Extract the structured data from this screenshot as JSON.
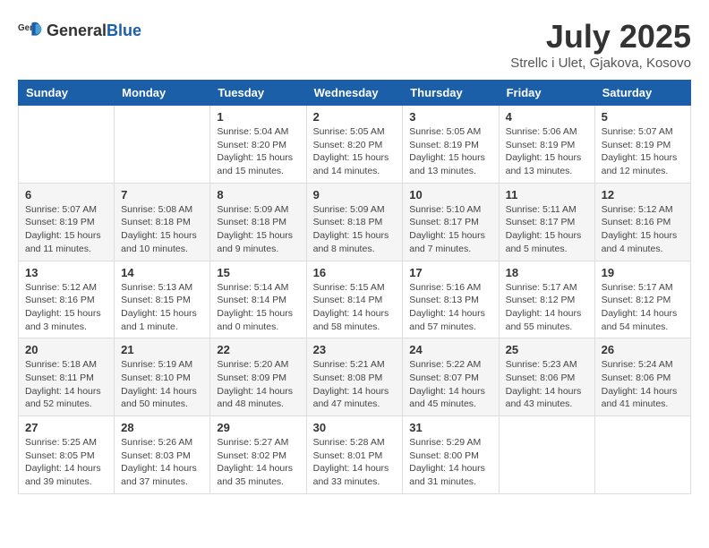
{
  "header": {
    "logo_general": "General",
    "logo_blue": "Blue",
    "month_title": "July 2025",
    "location": "Strellc i Ulet, Gjakova, Kosovo"
  },
  "weekdays": [
    "Sunday",
    "Monday",
    "Tuesday",
    "Wednesday",
    "Thursday",
    "Friday",
    "Saturday"
  ],
  "weeks": [
    [
      {
        "day": "",
        "info": ""
      },
      {
        "day": "",
        "info": ""
      },
      {
        "day": "1",
        "info": "Sunrise: 5:04 AM\nSunset: 8:20 PM\nDaylight: 15 hours and 15 minutes."
      },
      {
        "day": "2",
        "info": "Sunrise: 5:05 AM\nSunset: 8:20 PM\nDaylight: 15 hours and 14 minutes."
      },
      {
        "day": "3",
        "info": "Sunrise: 5:05 AM\nSunset: 8:19 PM\nDaylight: 15 hours and 13 minutes."
      },
      {
        "day": "4",
        "info": "Sunrise: 5:06 AM\nSunset: 8:19 PM\nDaylight: 15 hours and 13 minutes."
      },
      {
        "day": "5",
        "info": "Sunrise: 5:07 AM\nSunset: 8:19 PM\nDaylight: 15 hours and 12 minutes."
      }
    ],
    [
      {
        "day": "6",
        "info": "Sunrise: 5:07 AM\nSunset: 8:19 PM\nDaylight: 15 hours and 11 minutes."
      },
      {
        "day": "7",
        "info": "Sunrise: 5:08 AM\nSunset: 8:18 PM\nDaylight: 15 hours and 10 minutes."
      },
      {
        "day": "8",
        "info": "Sunrise: 5:09 AM\nSunset: 8:18 PM\nDaylight: 15 hours and 9 minutes."
      },
      {
        "day": "9",
        "info": "Sunrise: 5:09 AM\nSunset: 8:18 PM\nDaylight: 15 hours and 8 minutes."
      },
      {
        "day": "10",
        "info": "Sunrise: 5:10 AM\nSunset: 8:17 PM\nDaylight: 15 hours and 7 minutes."
      },
      {
        "day": "11",
        "info": "Sunrise: 5:11 AM\nSunset: 8:17 PM\nDaylight: 15 hours and 5 minutes."
      },
      {
        "day": "12",
        "info": "Sunrise: 5:12 AM\nSunset: 8:16 PM\nDaylight: 15 hours and 4 minutes."
      }
    ],
    [
      {
        "day": "13",
        "info": "Sunrise: 5:12 AM\nSunset: 8:16 PM\nDaylight: 15 hours and 3 minutes."
      },
      {
        "day": "14",
        "info": "Sunrise: 5:13 AM\nSunset: 8:15 PM\nDaylight: 15 hours and 1 minute."
      },
      {
        "day": "15",
        "info": "Sunrise: 5:14 AM\nSunset: 8:14 PM\nDaylight: 15 hours and 0 minutes."
      },
      {
        "day": "16",
        "info": "Sunrise: 5:15 AM\nSunset: 8:14 PM\nDaylight: 14 hours and 58 minutes."
      },
      {
        "day": "17",
        "info": "Sunrise: 5:16 AM\nSunset: 8:13 PM\nDaylight: 14 hours and 57 minutes."
      },
      {
        "day": "18",
        "info": "Sunrise: 5:17 AM\nSunset: 8:12 PM\nDaylight: 14 hours and 55 minutes."
      },
      {
        "day": "19",
        "info": "Sunrise: 5:17 AM\nSunset: 8:12 PM\nDaylight: 14 hours and 54 minutes."
      }
    ],
    [
      {
        "day": "20",
        "info": "Sunrise: 5:18 AM\nSunset: 8:11 PM\nDaylight: 14 hours and 52 minutes."
      },
      {
        "day": "21",
        "info": "Sunrise: 5:19 AM\nSunset: 8:10 PM\nDaylight: 14 hours and 50 minutes."
      },
      {
        "day": "22",
        "info": "Sunrise: 5:20 AM\nSunset: 8:09 PM\nDaylight: 14 hours and 48 minutes."
      },
      {
        "day": "23",
        "info": "Sunrise: 5:21 AM\nSunset: 8:08 PM\nDaylight: 14 hours and 47 minutes."
      },
      {
        "day": "24",
        "info": "Sunrise: 5:22 AM\nSunset: 8:07 PM\nDaylight: 14 hours and 45 minutes."
      },
      {
        "day": "25",
        "info": "Sunrise: 5:23 AM\nSunset: 8:06 PM\nDaylight: 14 hours and 43 minutes."
      },
      {
        "day": "26",
        "info": "Sunrise: 5:24 AM\nSunset: 8:06 PM\nDaylight: 14 hours and 41 minutes."
      }
    ],
    [
      {
        "day": "27",
        "info": "Sunrise: 5:25 AM\nSunset: 8:05 PM\nDaylight: 14 hours and 39 minutes."
      },
      {
        "day": "28",
        "info": "Sunrise: 5:26 AM\nSunset: 8:03 PM\nDaylight: 14 hours and 37 minutes."
      },
      {
        "day": "29",
        "info": "Sunrise: 5:27 AM\nSunset: 8:02 PM\nDaylight: 14 hours and 35 minutes."
      },
      {
        "day": "30",
        "info": "Sunrise: 5:28 AM\nSunset: 8:01 PM\nDaylight: 14 hours and 33 minutes."
      },
      {
        "day": "31",
        "info": "Sunrise: 5:29 AM\nSunset: 8:00 PM\nDaylight: 14 hours and 31 minutes."
      },
      {
        "day": "",
        "info": ""
      },
      {
        "day": "",
        "info": ""
      }
    ]
  ]
}
